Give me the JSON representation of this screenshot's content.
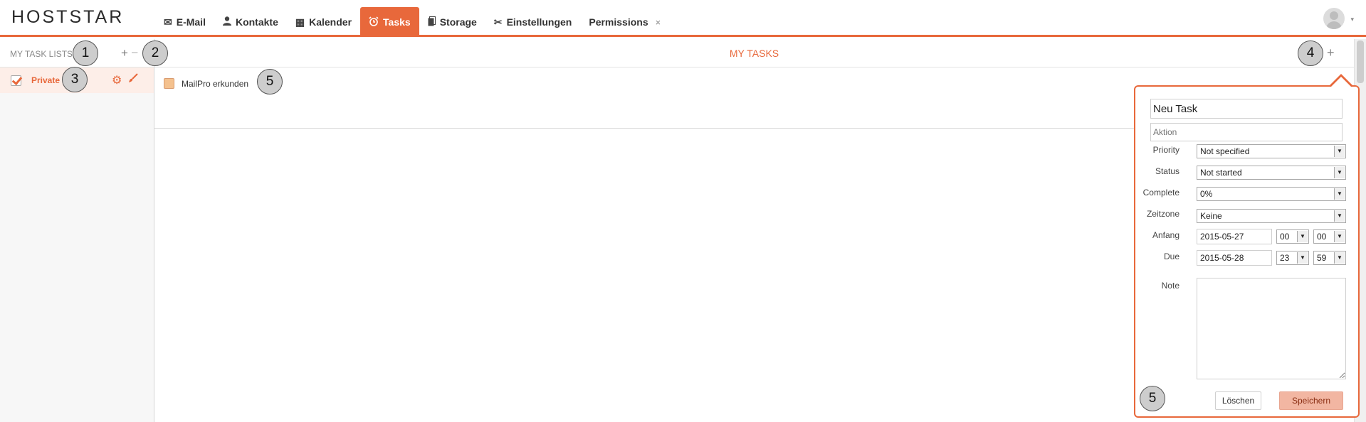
{
  "app": {
    "logo": "HOSTSTAR"
  },
  "nav": {
    "items": [
      {
        "label": "E-Mail",
        "icon": "envelope-icon",
        "glyph": "✉"
      },
      {
        "label": "Kontakte",
        "icon": "person-icon",
        "glyph": "👤"
      },
      {
        "label": "Kalender",
        "icon": "calendar-icon",
        "glyph": "▦"
      },
      {
        "label": "Tasks",
        "icon": "alarm-clock-icon",
        "glyph": "⏰",
        "active": true
      },
      {
        "label": "Storage",
        "icon": "files-icon",
        "glyph": "▯"
      },
      {
        "label": "Einstellungen",
        "icon": "tools-icon",
        "glyph": "✂"
      },
      {
        "label": "Permissions",
        "close": "×"
      }
    ]
  },
  "sidebar": {
    "title": "MY TASK LISTS",
    "add": "+",
    "remove": "–",
    "lists": [
      {
        "label": "Private",
        "checked": true
      }
    ]
  },
  "main": {
    "title": "MY TASKS",
    "add": "+",
    "tasks": [
      {
        "label": "MailPro erkunden"
      }
    ]
  },
  "editor": {
    "title_value": "Neu Task",
    "action_placeholder": "Aktion",
    "priority": {
      "label": "Priority",
      "value": "Not specified"
    },
    "status": {
      "label": "Status",
      "value": "Not started"
    },
    "complete": {
      "label": "Complete",
      "value": "0%"
    },
    "timezone": {
      "label": "Zeitzone",
      "value": "Keine"
    },
    "start": {
      "label": "Anfang",
      "date": "2015-05-27",
      "hour": "00",
      "minute": "00"
    },
    "due": {
      "label": "Due",
      "date": "2015-05-28",
      "hour": "23",
      "minute": "59"
    },
    "note": {
      "label": "Note"
    },
    "delete_label": "Löschen",
    "save_label": "Speichern"
  },
  "markers": [
    "1",
    "2",
    "3",
    "4",
    "5",
    "5"
  ],
  "colors": {
    "accent": "#e8683b",
    "save_bg": "#f2b6a2"
  }
}
